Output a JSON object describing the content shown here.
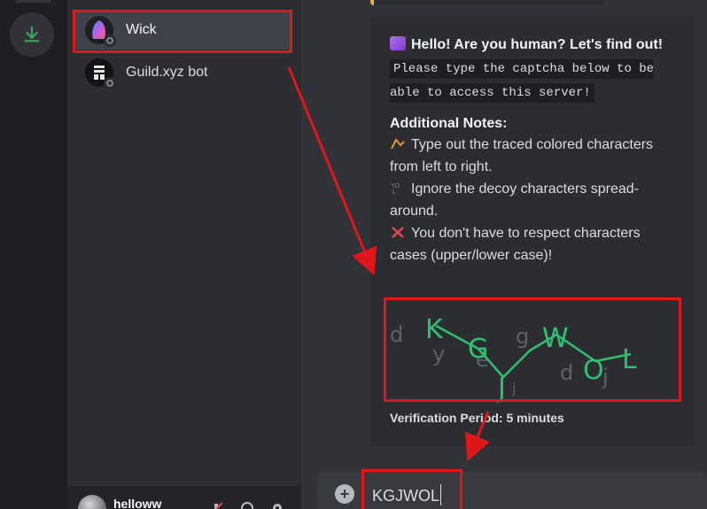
{
  "sidebar": {
    "dms": [
      {
        "name": "Wick",
        "avatar": "wick-avatar",
        "active": true
      },
      {
        "name": "Guild.xyz bot",
        "avatar": "guild-avatar",
        "active": false
      }
    ],
    "user": {
      "name": "helloww"
    }
  },
  "embed": {
    "title": "Hello! Are you human? Let's find out!",
    "code_text": "Please type the captcha below to be able to access this server!",
    "notes_heading": "Additional Notes:",
    "notes": [
      "Type out the traced colored characters from left to right.",
      "Ignore the decoy characters spread-around.",
      "You don't have to respect characters cases (upper/lower case)!"
    ],
    "captcha": {
      "traced": [
        "K",
        "G",
        "J",
        "W",
        "O",
        "L"
      ],
      "decoys": [
        "d",
        "y",
        "e",
        "g",
        "d",
        "j",
        "j"
      ]
    },
    "verification": "Verification Period: 5 minutes"
  },
  "composer": {
    "value": "KGJWOL"
  },
  "colors": {
    "accent_green": "#3ba55d",
    "captcha_green": "#2fbf71",
    "annotation_red": "#e0161b",
    "embed_bar": "#f0b232"
  }
}
